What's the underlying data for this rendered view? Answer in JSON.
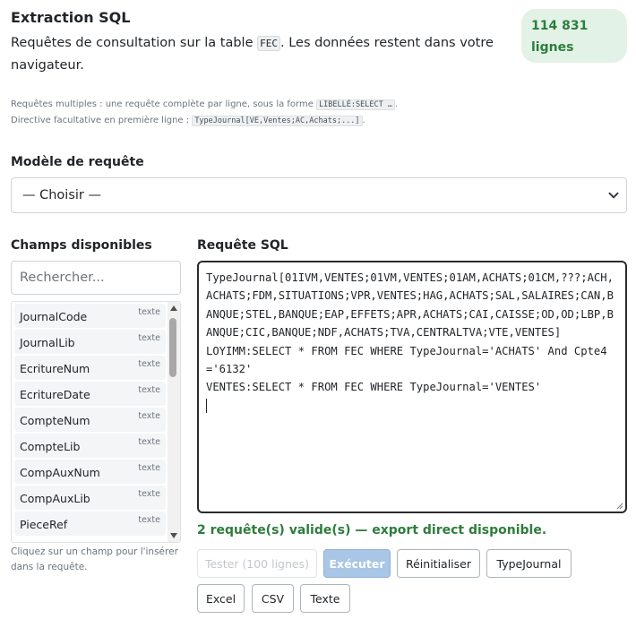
{
  "header": {
    "title": "Extraction SQL",
    "subtitle_before": "Requêtes de consultation sur la table ",
    "subtitle_code": "FEC",
    "subtitle_after": ". Les données restent dans votre navigateur."
  },
  "row_count": {
    "value": "114 831",
    "unit": "lignes"
  },
  "hint": {
    "line1_text": "Requêtes multiples : une requête complète par ligne, sous la forme ",
    "line1_code": "LIBELLÉ:SELECT …",
    "line1_end": ".",
    "line2_text": "Directive facultative en première ligne : ",
    "line2_code": "TypeJournal[VE,Ventes;AC,Achats;...]",
    "line2_end": "."
  },
  "template_select": {
    "label": "Modèle de requête",
    "selected": "— Choisir —"
  },
  "fields_panel": {
    "label": "Champs disponibles",
    "search_placeholder": "Rechercher...",
    "fields": [
      {
        "name": "JournalCode",
        "type": "texte"
      },
      {
        "name": "JournalLib",
        "type": "texte"
      },
      {
        "name": "EcritureNum",
        "type": "texte"
      },
      {
        "name": "EcritureDate",
        "type": "texte"
      },
      {
        "name": "CompteNum",
        "type": "texte"
      },
      {
        "name": "CompteLib",
        "type": "texte"
      },
      {
        "name": "CompAuxNum",
        "type": "texte"
      },
      {
        "name": "CompAuxLib",
        "type": "texte"
      },
      {
        "name": "PieceRef",
        "type": "texte"
      }
    ],
    "help": "Cliquez sur un champ pour l'insérer dans la requête."
  },
  "sql_editor": {
    "label": "Requête SQL",
    "content": "TypeJournal[01IVM,VENTES;01VM,VENTES;01AM,ACHATS;01CM,???;ACH,ACHATS;FDM,SITUATIONS;VPR,VENTES;HAG,ACHATS;SAL,SALAIRES;CAN,BANQUE;STEL,BANQUE;EAP,EFFETS;APR,ACHATS;CAI,CAISSE;OD,OD;LBP,BANQUE;CIC,BANQUE;NDF,ACHATS;TVA,CENTRALTVA;VTE,VENTES]\nLOYIMM:SELECT * FROM FEC WHERE TypeJournal='ACHATS' And Cpte4='6132'\nVENTES:SELECT * FROM FEC WHERE TypeJournal='VENTES'\n"
  },
  "status": "2 requête(s) valide(s) — export direct disponible.",
  "buttons": {
    "test": "Tester (100 lignes)",
    "run": "Exécuter",
    "reset": "Réinitialiser",
    "type_journal": "TypeJournal",
    "excel": "Excel",
    "csv": "CSV",
    "text": "Texte"
  },
  "colors": {
    "accent_green": "#2e7d3c",
    "badge_bg": "#e3f2e6",
    "primary_button": "#a9c6e6"
  }
}
